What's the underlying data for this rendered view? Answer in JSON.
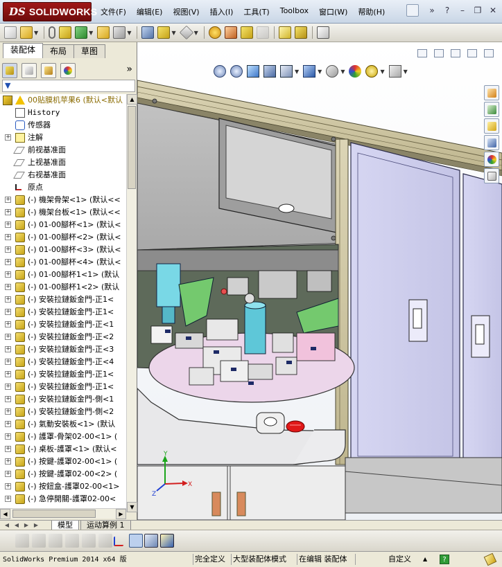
{
  "app": {
    "logo_ds": "DS",
    "logo_brand": "SOLIDWORKS"
  },
  "menu": [
    {
      "label": "文件(F)",
      "name": "menu-file"
    },
    {
      "label": "编辑(E)",
      "name": "menu-edit"
    },
    {
      "label": "视图(V)",
      "name": "menu-view"
    },
    {
      "label": "插入(I)",
      "name": "menu-insert"
    },
    {
      "label": "工具(T)",
      "name": "menu-tools"
    },
    {
      "label": "Toolbox",
      "name": "menu-toolbox"
    },
    {
      "label": "窗口(W)",
      "name": "menu-window"
    },
    {
      "label": "帮助(H)",
      "name": "menu-help"
    }
  ],
  "title_right": {
    "more": "»",
    "help": "?",
    "minimize": "–",
    "restore": "❐",
    "close": "✕"
  },
  "left_tabs": [
    {
      "label": "装配体",
      "active": true
    },
    {
      "label": "布局",
      "active": false
    },
    {
      "label": "草图",
      "active": false
    }
  ],
  "feature_manager": {
    "chevron": "»",
    "filter_icon": "▼",
    "tree": [
      {
        "label": "00贴膜机苹果6  (默认<默认",
        "icon": "assembly",
        "expand": false,
        "level": 0,
        "warn": true
      },
      {
        "label": "History",
        "icon": "history",
        "expand": false,
        "level": 1,
        "mono": true
      },
      {
        "label": "传感器",
        "icon": "sensor",
        "expand": false,
        "level": 1
      },
      {
        "label": "注解",
        "icon": "annotation",
        "expand": true,
        "level": 1
      },
      {
        "label": "前视基准面",
        "icon": "plane",
        "expand": false,
        "level": 1
      },
      {
        "label": "上视基准面",
        "icon": "plane",
        "expand": false,
        "level": 1
      },
      {
        "label": "右视基准面",
        "icon": "plane",
        "expand": false,
        "level": 1
      },
      {
        "label": "原点",
        "icon": "origin",
        "expand": false,
        "level": 1
      },
      {
        "label": "(-) 機架骨架<1> (默认<<",
        "icon": "part",
        "expand": true,
        "level": 1
      },
      {
        "label": "(-) 機架台板<1> (默认<<",
        "icon": "part",
        "expand": true,
        "level": 1
      },
      {
        "label": "(-) 01-00腳杯<1> (默认<",
        "icon": "part",
        "expand": true,
        "level": 1
      },
      {
        "label": "(-) 01-00腳杯<2> (默认<",
        "icon": "part",
        "expand": true,
        "level": 1
      },
      {
        "label": "(-) 01-00腳杯<3> (默认<",
        "icon": "part",
        "expand": true,
        "level": 1
      },
      {
        "label": "(-) 01-00腳杯<4> (默认<",
        "icon": "part",
        "expand": true,
        "level": 1
      },
      {
        "label": "(-) 01-00腳杯1<1> (默认",
        "icon": "part",
        "expand": true,
        "level": 1
      },
      {
        "label": "(-) 01-00腳杯1<2> (默认",
        "icon": "part",
        "expand": true,
        "level": 1
      },
      {
        "label": "(-) 安裝拉鏈鈑金門-正1<",
        "icon": "part",
        "expand": true,
        "level": 1
      },
      {
        "label": "(-) 安裝拉鏈鈑金門-正1<",
        "icon": "part",
        "expand": true,
        "level": 1
      },
      {
        "label": "(-) 安裝拉鏈鈑金門-正<1",
        "icon": "part",
        "expand": true,
        "level": 1
      },
      {
        "label": "(-) 安裝拉鏈鈑金門-正<2",
        "icon": "part",
        "expand": true,
        "level": 1
      },
      {
        "label": "(-) 安裝拉鏈鈑金門-正<3",
        "icon": "part",
        "expand": true,
        "level": 1
      },
      {
        "label": "(-) 安裝拉鏈鈑金門-正<4",
        "icon": "part",
        "expand": true,
        "level": 1
      },
      {
        "label": "(-) 安裝拉鏈鈑金門-正1<",
        "icon": "part",
        "expand": true,
        "level": 1
      },
      {
        "label": "(-) 安裝拉鏈鈑金門-正1<",
        "icon": "part",
        "expand": true,
        "level": 1
      },
      {
        "label": "(-) 安裝拉鏈鈑金門-側<1",
        "icon": "part",
        "expand": true,
        "level": 1
      },
      {
        "label": "(-) 安裝拉鏈鈑金門-側<2",
        "icon": "part",
        "expand": true,
        "level": 1
      },
      {
        "label": "(-) 氣動安裝板<1> (默认",
        "icon": "part",
        "expand": true,
        "level": 1
      },
      {
        "label": "(-) 護罩-骨架02-00<1> (",
        "icon": "part",
        "expand": true,
        "level": 1
      },
      {
        "label": "(-) 桌板-護罩<1> (默认<",
        "icon": "part",
        "expand": true,
        "level": 1
      },
      {
        "label": "(-) 按鍵-護罩02-00<1> (",
        "icon": "part",
        "expand": true,
        "level": 1
      },
      {
        "label": "(-) 按鍵-護罩02-00<2> (",
        "icon": "part",
        "expand": true,
        "level": 1
      },
      {
        "label": "(-) 按鈕盒-護罩02-00<1>",
        "icon": "part",
        "expand": true,
        "level": 1
      },
      {
        "label": "(-) 急停開關-護罩02-00<",
        "icon": "part",
        "expand": true,
        "level": 1
      }
    ]
  },
  "bottom_tabs": [
    {
      "label": "模型",
      "active": true
    },
    {
      "label": "运动算例 1",
      "active": false
    }
  ],
  "status": {
    "product": "SolidWorks Premium 2014 x64 版",
    "fully_defined": "完全定义",
    "large_assembly": "大型装配体模式",
    "editing": "在编辑 装配体",
    "custom": "自定义",
    "custom_arrow": "▲",
    "help": "?"
  },
  "colors": {
    "panel_bg": "#ece9d8",
    "sw_red": "#8e1414",
    "door_purple": "#d8d8f4",
    "table_pink": "#ecd6ea"
  }
}
